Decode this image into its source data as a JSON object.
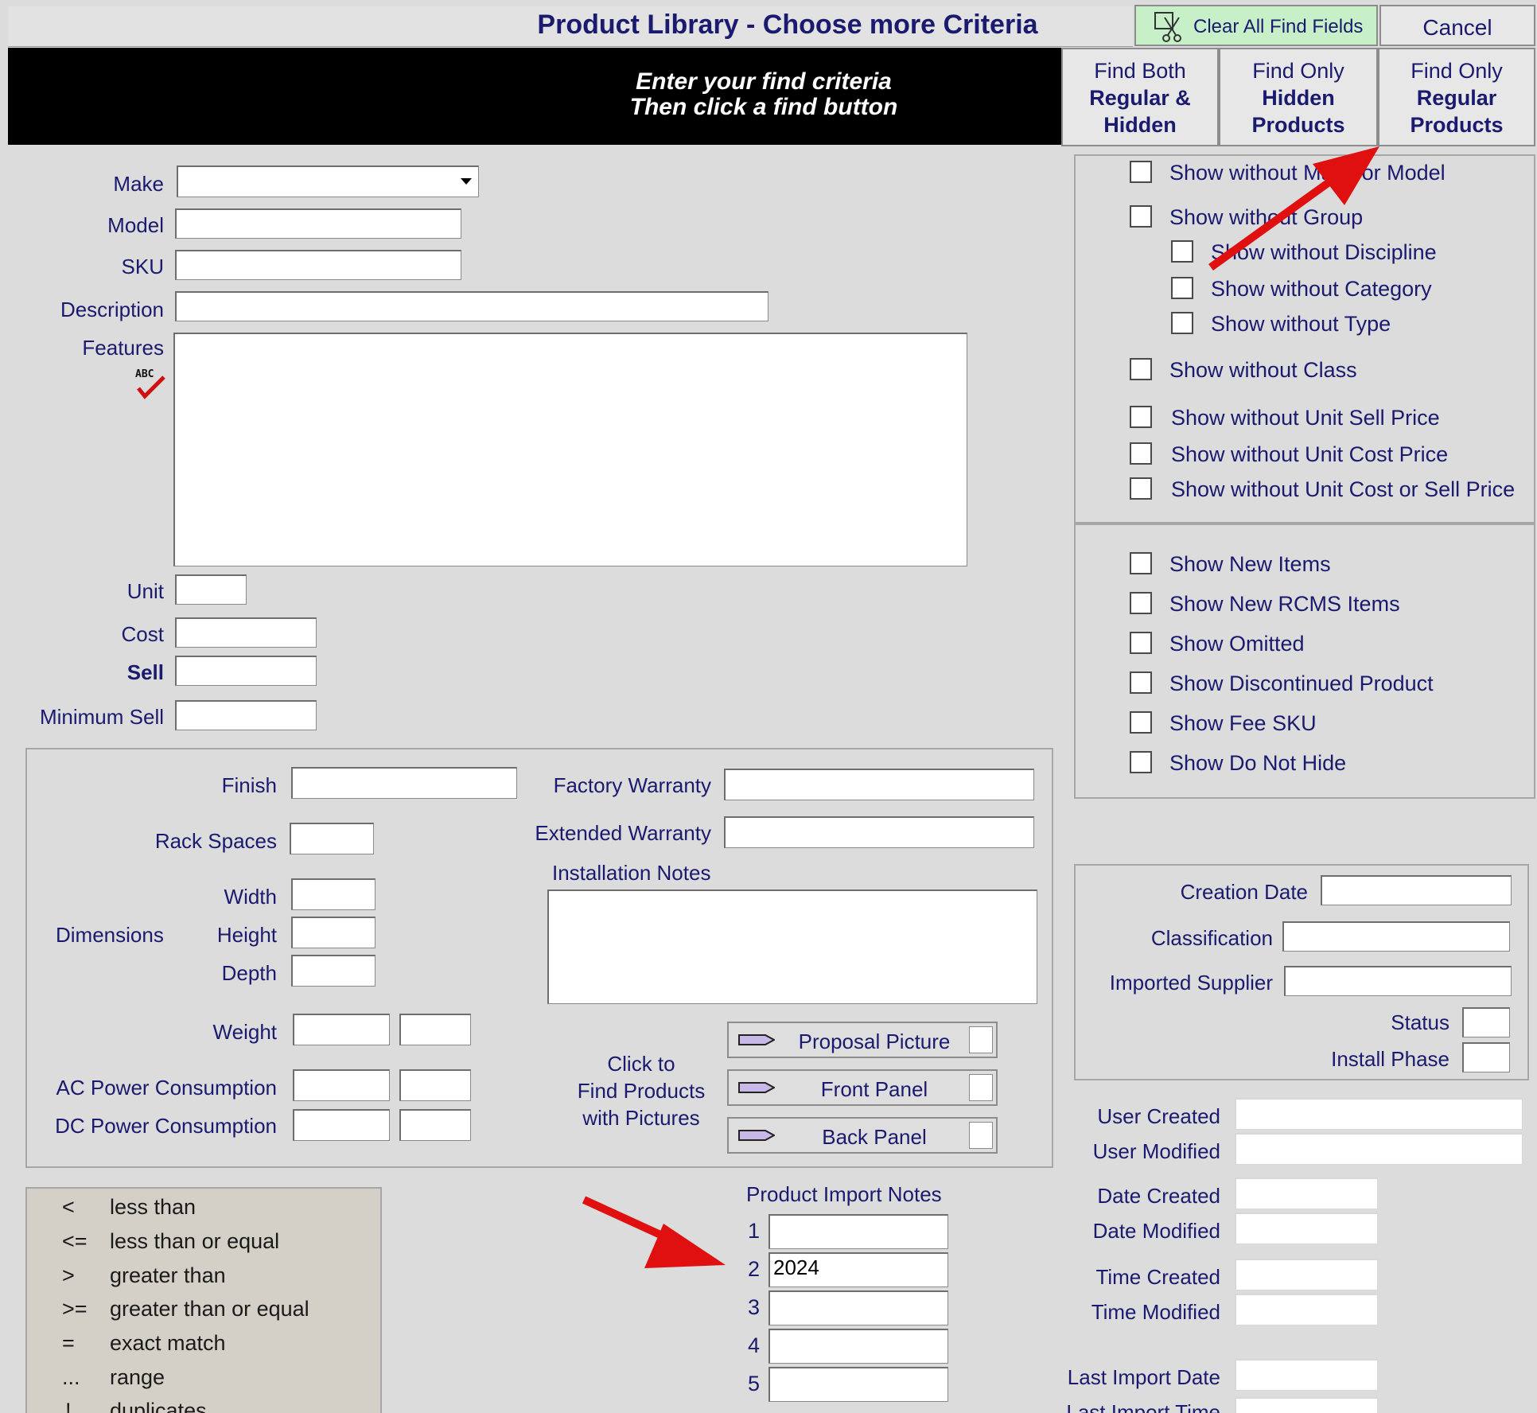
{
  "title_bar": {
    "title": "Product Library - Choose more Criteria",
    "clear_label": "Clear All Find Fields",
    "cancel_label": "Cancel"
  },
  "banner": {
    "line1": "Enter your find criteria",
    "line2": "Then click a find button"
  },
  "find_buttons": {
    "both": [
      "Find Both",
      "Regular &",
      "Hidden"
    ],
    "hidden": [
      "Find Only",
      "Hidden",
      "Products"
    ],
    "regular": [
      "Find Only",
      "Regular",
      "Products"
    ]
  },
  "fields": {
    "make": "Make",
    "model": "Model",
    "sku": "SKU",
    "description": "Description",
    "features": "Features",
    "unit": "Unit",
    "cost": "Cost",
    "sell": "Sell",
    "minimum_sell": "Minimum Sell"
  },
  "specs": {
    "finish": "Finish",
    "rack_spaces": "Rack Spaces",
    "dimensions": "Dimensions",
    "width": "Width",
    "height": "Height",
    "depth": "Depth",
    "weight": "Weight",
    "ac_power": "AC Power Consumption",
    "dc_power": "DC Power Consumption",
    "factory_warranty": "Factory Warranty",
    "extended_warranty": "Extended Warranty",
    "installation_notes": "Installation Notes",
    "click_to": [
      "Click to",
      "Find Products",
      "with Pictures"
    ],
    "proposal_picture": "Proposal Picture",
    "front_panel": "Front Panel",
    "back_panel": "Back Panel"
  },
  "checks_top": [
    "Show without Make or Model",
    "Show without Group",
    "Show without Discipline",
    "Show without Category",
    "Show without Type",
    "Show without Class",
    "Show without Unit Sell Price",
    "Show without Unit Cost Price",
    "Show without Unit Cost or Sell Price"
  ],
  "checks_bottom": [
    "Show New Items",
    "Show New RCMS Items",
    "Show Omitted",
    "Show Discontinued Product",
    "Show Fee SKU",
    "Show Do Not Hide"
  ],
  "meta": {
    "creation_date": "Creation Date",
    "classification": "Classification",
    "imported_supplier": "Imported Supplier",
    "status": "Status",
    "install_phase": "Install Phase"
  },
  "audit": {
    "user_created": "User Created",
    "user_modified": "User Modified",
    "date_created": "Date Created",
    "date_modified": "Date Modified",
    "time_created": "Time Created",
    "time_modified": "Time Modified",
    "last_import_date": "Last Import Date",
    "last_import_time": "Last Import Time"
  },
  "import_notes": {
    "title": "Product Import Notes",
    "nums": [
      "1",
      "2",
      "3",
      "4",
      "5"
    ],
    "values": [
      "",
      "2024",
      "",
      "",
      ""
    ]
  },
  "operators": [
    {
      "sym": "<",
      "desc": "less than"
    },
    {
      "sym": "<=",
      "desc": "less than or equal"
    },
    {
      "sym": ">",
      "desc": "greater than"
    },
    {
      "sym": ">=",
      "desc": "greater than or equal"
    },
    {
      "sym": "=",
      "desc": "exact match"
    },
    {
      "sym": "...",
      "desc": "range"
    },
    {
      "sym": "!",
      "desc": "duplicates"
    }
  ],
  "colors": {
    "accent_arrow": "#e01010",
    "clear_button_bg": "#c8f0c8"
  }
}
